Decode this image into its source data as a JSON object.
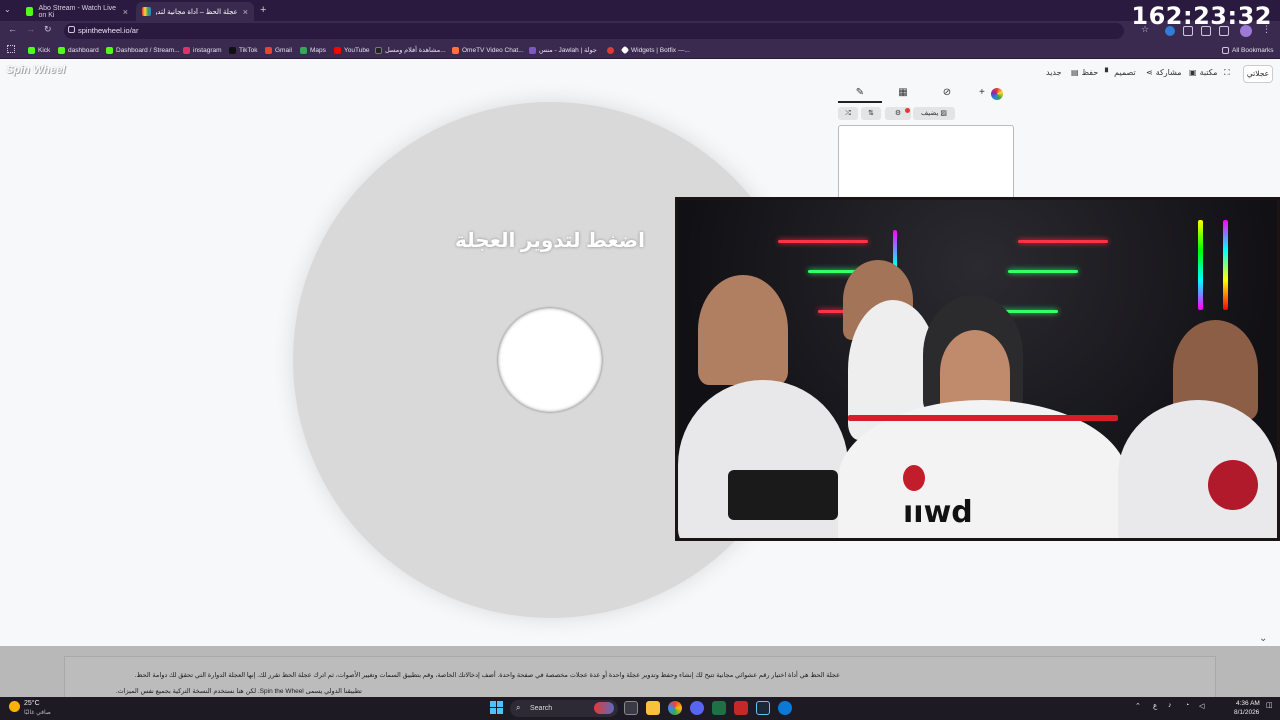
{
  "browser": {
    "tabs": [
      {
        "label": "Abo Stream - Watch Live on Ki",
        "fav_color": "#53fc18"
      },
      {
        "label": "عجلة الحظ – أداة مجانية لتدوير ال",
        "fav_color": "#e8a13c"
      }
    ],
    "url": "spinthewheel.io/ar",
    "bookmarks": [
      {
        "label": "Kick",
        "color": "#53fc18"
      },
      {
        "label": "dashboard",
        "color": "#53fc18"
      },
      {
        "label": "Dashboard / Stream...",
        "color": "#53fc18"
      },
      {
        "label": "instagram",
        "color": "#e1306c"
      },
      {
        "label": "TikTok",
        "color": "#111111"
      },
      {
        "label": "Gmail",
        "color": "#ea4335"
      },
      {
        "label": "Maps",
        "color": "#34a853"
      },
      {
        "label": "YouTube",
        "color": "#ff0000"
      },
      {
        "label": "مشاهدة أفلام ومسل...",
        "color": "#222222"
      },
      {
        "label": "OmeTV Video Chat...",
        "color": "#ff7043"
      },
      {
        "label": "منس - Jawlah | جولة",
        "color": "#7e57c2"
      },
      {
        "label": "",
        "color": "#e53935"
      },
      {
        "label": "Widgets | Botfix —...",
        "color": "#ffffff"
      }
    ],
    "all_bookmarks": "All Bookmarks"
  },
  "clock": "162:23:32",
  "site": {
    "logo": "Spin Wheel",
    "menu": {
      "my_wheels": "عجلاتي",
      "library": "مكتبة",
      "share": "مشاركة",
      "design": "تصميم",
      "save": "حفظ",
      "new": "جديد"
    },
    "wheel_prompt": "اضغط لتدوير العجلة",
    "editor": {
      "add_label": "+",
      "add_image_label": "يضيف"
    }
  },
  "info": {
    "line1": "عجلة الحظ هي أداة اختيار رقم عشوائي مجانية تتيح لك إنشاء وحفظ وتدوير عجلة واحدة أو عدة عجلات مخصصة في صفحة واحدة. أضف إدخالاتك الخاصة، وقم بتطبيق السمات وتغيير الأصوات، ثم اترك عجلة الحظ تقرر لك. إنها العجلة الدوارة التي تحقق لك دوامة الحظ.",
    "line2": "تطبيقنا الدولي يسمى Spin the Wheel. لكن هنا نستخدم النسخة التركية بجميع نفس الميزات."
  },
  "taskbar": {
    "weather_temp": "25°C",
    "weather_desc": "صافي غالبًا",
    "search": "Search",
    "time": "4:36 AM",
    "date": "8/1/2026",
    "lang": "ع"
  },
  "colors": {
    "chrome_dark": "#2a1a3f",
    "chrome_mid": "#3a2a50",
    "wheel": "#d9d9d9",
    "taskbar": "#1d1a24"
  }
}
